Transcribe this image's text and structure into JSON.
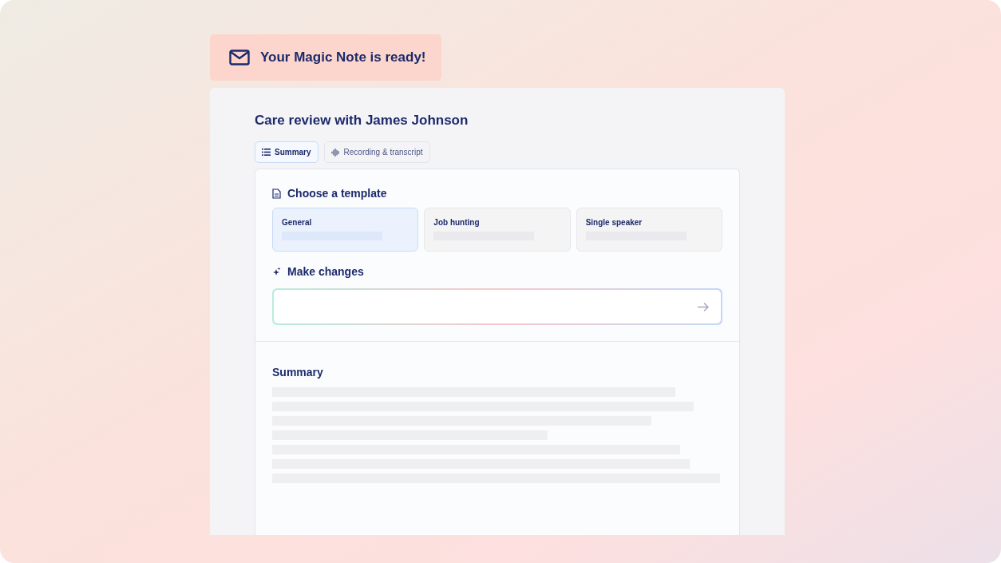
{
  "toast": {
    "message": "Your Magic Note is ready!"
  },
  "note": {
    "title": "Care review with James Johnson",
    "tabs": [
      {
        "label": "Summary",
        "selected": true
      },
      {
        "label": "Recording & transcript",
        "selected": false
      }
    ],
    "template_section": {
      "heading": "Choose a template",
      "templates": [
        {
          "name": "General",
          "selected": true
        },
        {
          "name": "Job hunting",
          "selected": false
        },
        {
          "name": "Single speaker",
          "selected": false
        }
      ]
    },
    "changes_section": {
      "heading": "Make changes"
    },
    "summary": {
      "heading": "Summary"
    }
  }
}
